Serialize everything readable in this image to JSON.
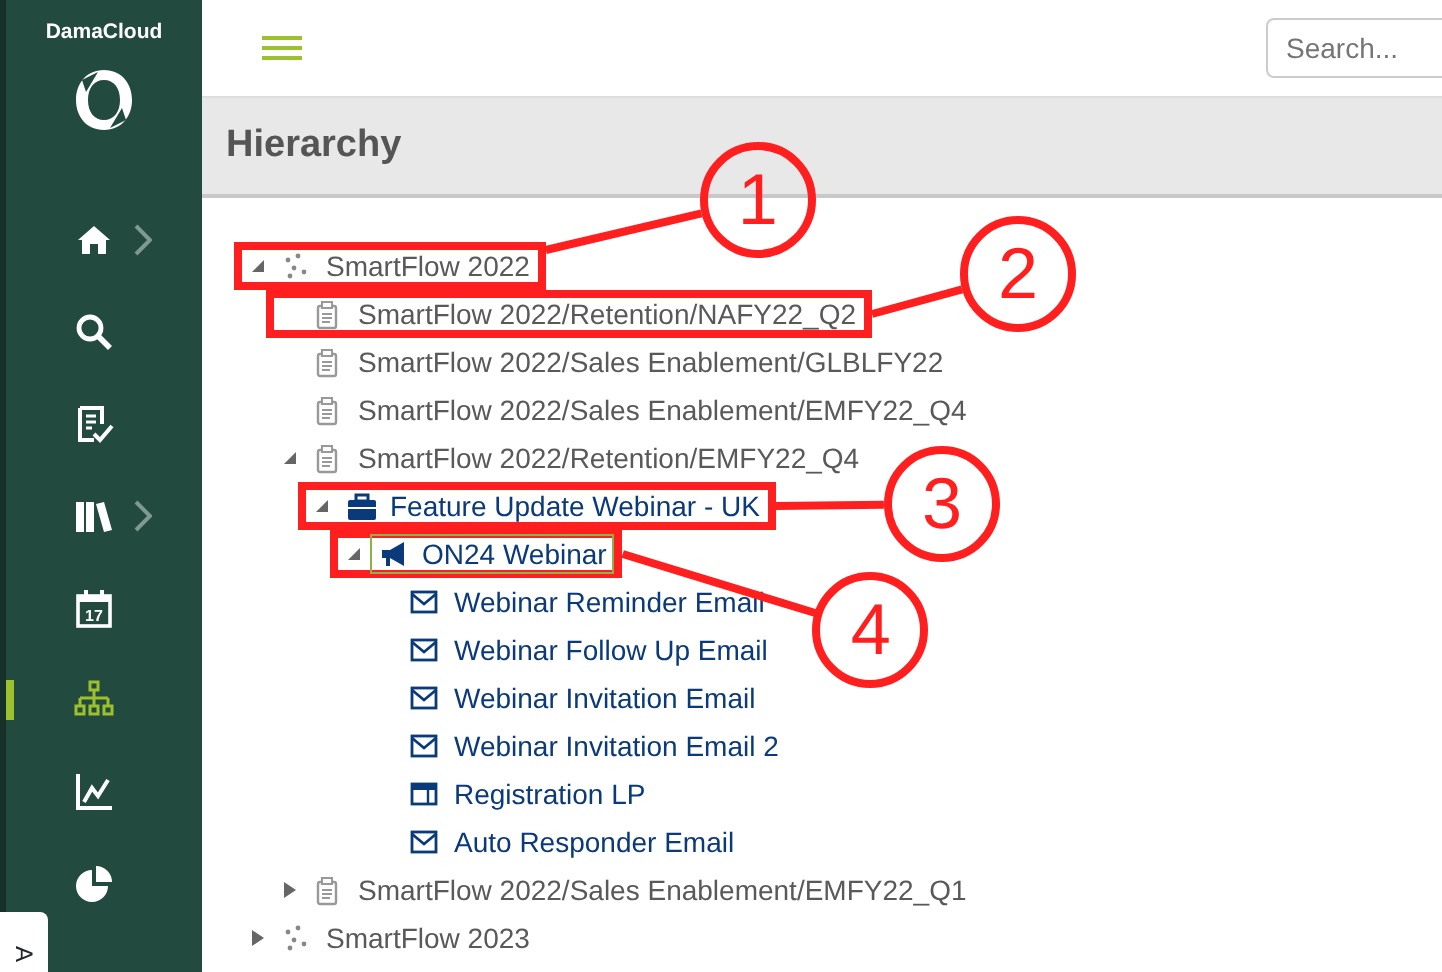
{
  "sidebar": {
    "brand": "DamaCloud",
    "items": [
      {
        "kind": "home",
        "submenu": true,
        "selected": false
      },
      {
        "kind": "search",
        "submenu": false,
        "selected": false
      },
      {
        "kind": "tasks",
        "submenu": false,
        "selected": false
      },
      {
        "kind": "library",
        "submenu": true,
        "selected": false
      },
      {
        "kind": "calendar",
        "day": "17",
        "submenu": false,
        "selected": false
      },
      {
        "kind": "hierarchy",
        "submenu": false,
        "selected": true
      },
      {
        "kind": "chart",
        "submenu": false,
        "selected": false
      },
      {
        "kind": "pie",
        "submenu": false,
        "selected": false
      }
    ],
    "side_tab": "A"
  },
  "search": {
    "placeholder": "Search..."
  },
  "page_title": "Hierarchy",
  "tree": [
    {
      "kind": "flow",
      "label": "SmartFlow 2022",
      "expanded": true,
      "selected": false,
      "callout": "1",
      "children": [
        {
          "kind": "plan",
          "label": "SmartFlow 2022/Retention/NAFY22_Q2",
          "selected": false,
          "callout": "2"
        },
        {
          "kind": "plan",
          "label": "SmartFlow 2022/Sales Enablement/GLBLFY22",
          "selected": false
        },
        {
          "kind": "plan",
          "label": "SmartFlow 2022/Sales Enablement/EMFY22_Q4",
          "selected": false
        },
        {
          "kind": "plan",
          "label": "SmartFlow 2022/Retention/EMFY22_Q4",
          "expanded": true,
          "selected": false,
          "children": [
            {
              "kind": "campaign",
              "label": "Feature Update Webinar - UK",
              "expanded": true,
              "selected": false,
              "callout": "3",
              "children": [
                {
                  "kind": "program",
                  "label": "ON24 Webinar",
                  "expanded": true,
                  "selected": true,
                  "callout": "4",
                  "children": [
                    {
                      "kind": "email",
                      "label": "Webinar Reminder Email",
                      "selected": false
                    },
                    {
                      "kind": "email",
                      "label": "Webinar Follow Up Email",
                      "selected": false
                    },
                    {
                      "kind": "email",
                      "label": "Webinar Invitation Email",
                      "selected": false
                    },
                    {
                      "kind": "email",
                      "label": "Webinar Invitation Email 2",
                      "selected": false
                    },
                    {
                      "kind": "page",
                      "label": "Registration LP",
                      "selected": false
                    },
                    {
                      "kind": "email",
                      "label": "Auto Responder Email",
                      "selected": false
                    }
                  ]
                }
              ]
            }
          ]
        },
        {
          "kind": "plan",
          "label": "SmartFlow 2022/Sales Enablement/EMFY22_Q1",
          "expanded": false,
          "selected": false
        }
      ]
    },
    {
      "kind": "flow",
      "label": "SmartFlow 2023",
      "expanded": false,
      "selected": false
    }
  ]
}
